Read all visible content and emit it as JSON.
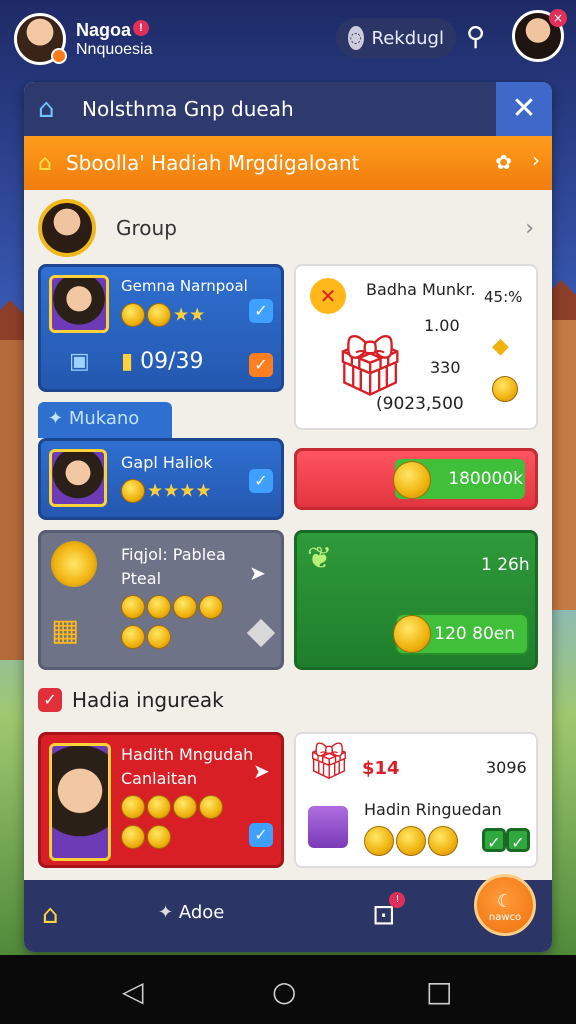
{
  "topbar": {
    "user_name": "Nagoa",
    "user_sub": "Nnquoesia",
    "badge": "!",
    "pill_label": "Rekdugl"
  },
  "panel": {
    "title": "Nolsthma Gnp dueah",
    "banner": "Sboolla' Hadiah Mrgdigaloant",
    "group_label": "Group"
  },
  "cards": {
    "card1": {
      "name": "Gemna Narnpoal",
      "count": "09/39"
    },
    "card2": {
      "title": "Badha Munkr.",
      "percent": "45:%",
      "v1": "1.00",
      "v2": "330",
      "v3": "(9023,500"
    },
    "tab": "Mukano",
    "card3": {
      "name": "Gapl Haliok"
    },
    "btn_red": "180000k",
    "card4": {
      "line1": "Fiqjol: Pablea",
      "line2": "Pteal"
    },
    "card5": {
      "value_top": "1 26h",
      "value_btn": "120 80en"
    }
  },
  "section": {
    "title": "Hadia ingureak",
    "card6": {
      "line1": "Hadith Mngudah",
      "line2": "Canlaitan"
    },
    "card7": {
      "price": "$14",
      "value": "3096",
      "label": "Hadin Ringuedan"
    }
  },
  "nav": {
    "about": "Adoe",
    "lock_badge": "!",
    "fab_label": "nawco"
  },
  "colors": {
    "accent_orange": "#f07c0c",
    "header_navy": "#2e3a6e",
    "card_blue": "#2f6fd0",
    "card_red": "#d81f26",
    "card_green": "#2e9a3a"
  }
}
